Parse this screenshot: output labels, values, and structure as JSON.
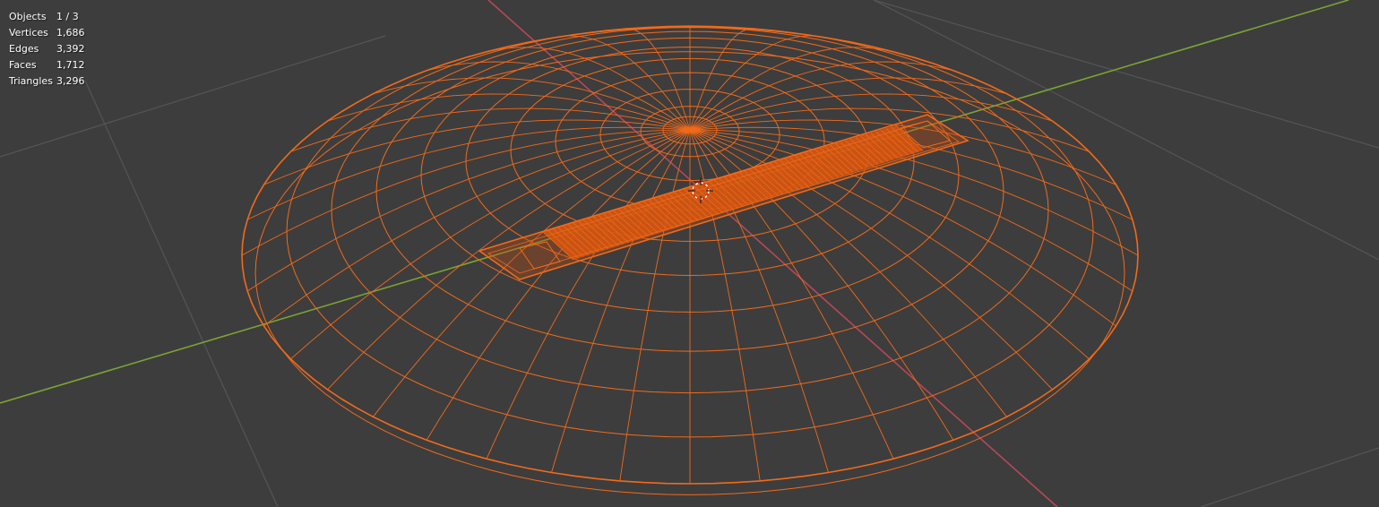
{
  "viewport": {
    "background": "#3d3d3d",
    "grid_color": "#555555",
    "x_axis_color": "#b5485a",
    "y_axis_color": "#7ca333",
    "wire_color": "#f26a1a",
    "cursor_icon": "3d-cursor-icon"
  },
  "stats": [
    {
      "label": "Objects",
      "value": "1 / 3"
    },
    {
      "label": "Vertices",
      "value": "1,686"
    },
    {
      "label": "Edges",
      "value": "3,392"
    },
    {
      "label": "Faces",
      "value": "1,712"
    },
    {
      "label": "Triangles",
      "value": "3,296"
    }
  ]
}
